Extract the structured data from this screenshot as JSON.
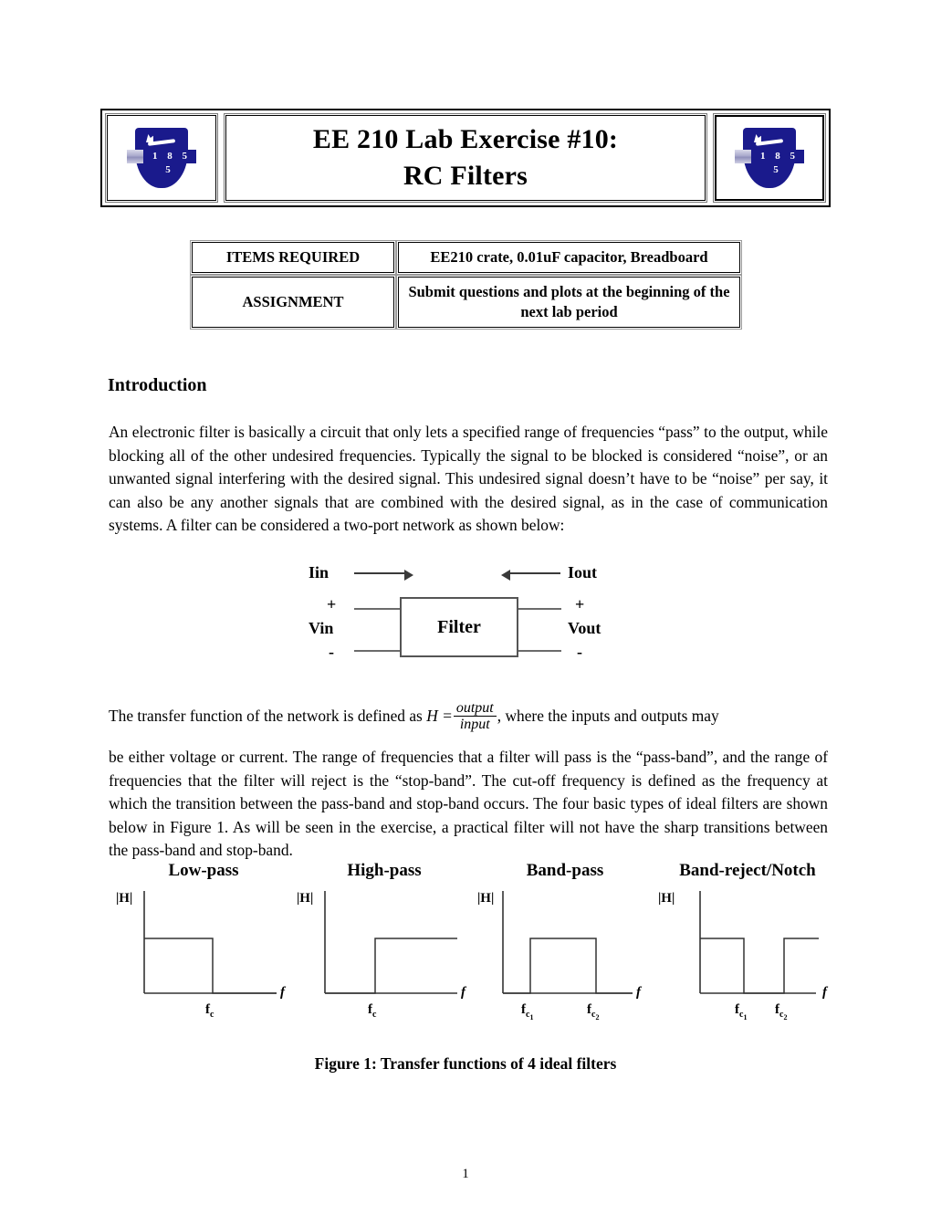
{
  "document": {
    "page_number": "1"
  },
  "header": {
    "title_line1": "EE 210 Lab Exercise #10:",
    "title_line2": "RC Filters",
    "logo_left": {
      "name": "university-shield-logo",
      "year": "1 8 5 5"
    },
    "logo_right": {
      "name": "university-shield-logo",
      "year": "1 8 5 5"
    }
  },
  "info_table": {
    "rows": [
      {
        "label": "ITEMS REQUIRED",
        "value": "EE210 crate, 0.01uF capacitor, Breadboard"
      },
      {
        "label": "ASSIGNMENT",
        "value": "Submit questions and plots at the beginning of the next lab period"
      }
    ]
  },
  "introduction": {
    "heading": "Introduction",
    "paragraph1": "An electronic filter is basically a circuit that only lets a specified range of frequencies “pass” to the output, while blocking all of the other undesired frequencies.  Typically the signal to be blocked is considered “noise”, or an unwanted signal interfering with the desired signal.  This undesired signal doesn’t have to be “noise” per say, it can also be any another signals that are combined with the desired signal, as in the case of communication systems.  A filter can be considered a two-port network as shown below:",
    "paragraph2_before_math": "The transfer function of the network is defined as",
    "math_H": "H =",
    "math_numerator": "output",
    "math_denominator": "input",
    "paragraph2_after_math": ", where the inputs and outputs may",
    "paragraph3": "be either voltage or current.  The range of frequencies that a filter will pass is the “pass-band”, and the range of frequencies that the filter will reject is the “stop-band”.  The cut-off frequency is defined as the frequency at which the transition between the pass-band and stop-band occurs.  The four basic types of ideal filters are shown below in Figure 1.  As will be seen in the exercise, a practical filter will not have the sharp transitions between the pass-band and stop-band."
  },
  "two_port_diagram": {
    "name": "two-port-network-diagram",
    "input_current_label": "Iin",
    "output_current_label": "Iout",
    "input_voltage_label": "Vin",
    "output_voltage_label": "Vout",
    "input_plus": "+",
    "input_minus": "-",
    "output_plus": "+",
    "output_minus": "-",
    "block_label": "Filter"
  },
  "figure1": {
    "caption": "Figure 1: Transfer functions of 4 ideal filters"
  },
  "chart_data": [
    {
      "type": "line",
      "title": "Low-pass",
      "xlabel": "f",
      "ylabel": "|H|",
      "tick_labels": [
        "fc"
      ],
      "tick_label_parts": [
        {
          "base": "f",
          "sub": "c",
          "subsub": ""
        }
      ],
      "description": "Magnitude is constant at the passband level from 0 to fc, then drops to 0 for f > fc",
      "x": [
        0,
        0.62,
        0.62,
        1.0
      ],
      "values": [
        1,
        1,
        0,
        0
      ],
      "cutoffs": [
        0.62
      ],
      "ylim": [
        0,
        1.35
      ],
      "xlim": [
        0,
        1.0
      ],
      "grid": false,
      "legend": "none"
    },
    {
      "type": "line",
      "title": "High-pass",
      "xlabel": "f",
      "ylabel": "|H|",
      "tick_labels": [
        "fc"
      ],
      "tick_label_parts": [
        {
          "base": "f",
          "sub": "c",
          "subsub": ""
        }
      ],
      "description": "Magnitude is 0 from 0 to fc, then constant at the passband level for f > fc",
      "x": [
        0,
        0.42,
        0.42,
        1.0
      ],
      "values": [
        0,
        0,
        1,
        1
      ],
      "cutoffs": [
        0.42
      ],
      "ylim": [
        0,
        1.35
      ],
      "xlim": [
        0,
        1.0
      ],
      "grid": false,
      "legend": "none"
    },
    {
      "type": "line",
      "title": "Band-pass",
      "xlabel": "f",
      "ylabel": "|H|",
      "tick_labels": [
        "fc1",
        "fc2"
      ],
      "tick_label_parts": [
        {
          "base": "f",
          "sub": "c",
          "subsub": "1"
        },
        {
          "base": "f",
          "sub": "c",
          "subsub": "2"
        }
      ],
      "description": "Magnitude is 0 below fc1, constant at the passband level between fc1 and fc2, and 0 above fc2",
      "x": [
        0,
        0.33,
        0.33,
        0.77,
        0.77,
        1.0
      ],
      "values": [
        0,
        0,
        1,
        1,
        0,
        0
      ],
      "cutoffs": [
        0.33,
        0.77
      ],
      "ylim": [
        0,
        1.35
      ],
      "xlim": [
        0,
        1.0
      ],
      "grid": false,
      "legend": "none"
    },
    {
      "type": "line",
      "title": "Band-reject/Notch",
      "xlabel": "f",
      "ylabel": "|H|",
      "tick_labels": [
        "fc1",
        "fc2"
      ],
      "tick_label_parts": [
        {
          "base": "f",
          "sub": "c",
          "subsub": "1"
        },
        {
          "base": "f",
          "sub": "c",
          "subsub": "2"
        }
      ],
      "description": "Magnitude is at the passband level below fc1, 0 between fc1 and fc2, and back at the passband level above fc2",
      "x": [
        0,
        0.36,
        0.36,
        0.62,
        0.62,
        1.0
      ],
      "values": [
        1,
        1,
        0,
        0,
        1,
        1
      ],
      "cutoffs": [
        0.36,
        0.62
      ],
      "ylim": [
        0,
        1.35
      ],
      "xlim": [
        0,
        1.0
      ],
      "grid": false,
      "legend": "none"
    }
  ]
}
